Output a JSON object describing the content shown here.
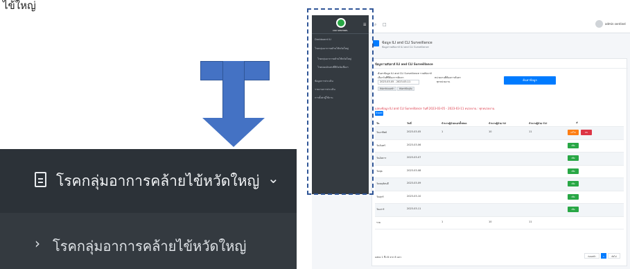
{
  "top_text": "ไข้ใหญ่",
  "zoom": {
    "menu_title": "โรคกลุ่มอาการคล้ายไข้หวัดใหญ่",
    "submenu_item": "โรคกลุ่มอาการคล้ายไข้หวัดใหญ่",
    "colors": {
      "sidebar_dark": "#2c3238",
      "sidebar": "#343a40",
      "arrow": "#4472c4"
    }
  },
  "app": {
    "brand": "CKD SENTINEL",
    "user_name": "admin sentinel",
    "sidebar_items": [
      "Dashboard ILI",
      "โรคกลุ่มอาการคล้ายไข้หวัดใหญ่",
      "โรคกลุ่มอาการคล้ายไข้หวัดใหญ่",
      "โรคปอดอักเสบที่มีปัจจัยเสี่ยงฯ",
      "ข้อมูลการประเมิน",
      "รายงานการประเมิน",
      "การตั้งค่าผู้ใช้งาน"
    ],
    "page_title": "ข้อมูล ILI and CLI Surveillance",
    "page_subtitle": "ข้อมูลรายสัปดาห์ ILI and CLI Surveillance"
  },
  "card": {
    "title": "ข้อมูลรายสัปดาห์ ILI and CLI Surveillance",
    "form_heading": "ค้นหาข้อมูล ILI and CLI Surveillance รายสัปดาห์",
    "date_label": "เลือกวันที่ที่ต้องการค้นหา",
    "date_value": "2023-03-05 - 2023-03-11",
    "unit_label": "หน่วยงานที่ต้องการค้นหา",
    "unit_value": "ทุกหน่วยงาน",
    "btn_prev": "สัปดาห์ก่อนหน้า",
    "btn_current": "สัปดาห์ปัจจุบัน",
    "search_button": "ค้นหาข้อมูล",
    "result_text": "แสดงข้อมูล ILI and CLI Surveillance วันที่ 2023-03-05 - 2023-03-11 หน่วยงาน : ทุกหน่วยงาน",
    "print_button": "Excel"
  },
  "table": {
    "columns": [
      "วัน",
      "วันที่",
      "จำนวนผู้ป่วยนอกทั้งหมด",
      "จำนวนผู้ป่วย ILI",
      "จำนวนผู้ป่วย CLI",
      "#"
    ],
    "rows": [
      {
        "day": "วันอาทิตย์",
        "date": "2023-03-05",
        "opd": "1",
        "ili": "10",
        "cli": "11",
        "actions": [
          "แก้ไข",
          "ลบ"
        ]
      },
      {
        "day": "วันจันทร์",
        "date": "2023-03-06",
        "opd": "",
        "ili": "",
        "cli": "",
        "actions": [
          "เพิ่ม"
        ]
      },
      {
        "day": "วันอังคาร",
        "date": "2023-03-07",
        "opd": "",
        "ili": "",
        "cli": "",
        "actions": [
          "เพิ่ม"
        ]
      },
      {
        "day": "วันพุธ",
        "date": "2023-03-08",
        "opd": "",
        "ili": "",
        "cli": "",
        "actions": [
          "เพิ่ม"
        ]
      },
      {
        "day": "วันพฤหัสบดี",
        "date": "2023-03-09",
        "opd": "",
        "ili": "",
        "cli": "",
        "actions": [
          "เพิ่ม"
        ]
      },
      {
        "day": "วันศุกร์",
        "date": "2023-03-10",
        "opd": "",
        "ili": "",
        "cli": "",
        "actions": [
          "เพิ่ม"
        ]
      },
      {
        "day": "วันเสาร์",
        "date": "2023-03-11",
        "opd": "",
        "ili": "",
        "cli": "",
        "actions": [
          "เพิ่ม"
        ]
      },
      {
        "day": "รวม",
        "date": "",
        "opd": "1",
        "ili": "10",
        "cli": "11",
        "actions": []
      }
    ],
    "footer": "แสดง 1 ถึง 8 จาก 8 แถว",
    "pager": [
      "ก่อนหน้า",
      "1",
      "ถัดไป"
    ]
  }
}
